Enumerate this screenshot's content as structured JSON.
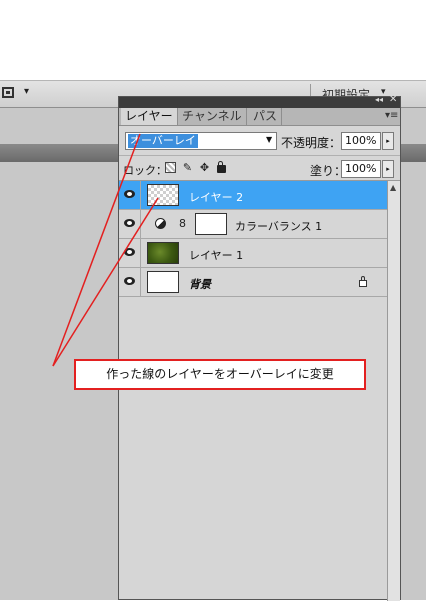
{
  "options_bar": {
    "screen_mode_icon": "screen-mode-icon",
    "screen_mode_arrow": "▾",
    "workspace_label": "初期設定",
    "workspace_arrow": "▾"
  },
  "panel": {
    "collapse_glyph": "◂◂",
    "close_glyph": "✕",
    "tabs": [
      {
        "label": "レイヤー",
        "active": true
      },
      {
        "label": "チャンネル",
        "active": false
      },
      {
        "label": "パス",
        "active": false
      }
    ],
    "menu_glyph": "▾≡",
    "blend_mode": {
      "value": "オーバーレイ",
      "arrow": "▼"
    },
    "opacity": {
      "label": "不透明度：",
      "value": "100%",
      "stepper": "▸"
    },
    "lock": {
      "label": "ロック：",
      "paint_glyph": "✎",
      "move_glyph": "✥"
    },
    "fill": {
      "label": "塗り：",
      "value": "100%",
      "stepper": "▸"
    },
    "layers": [
      {
        "name": "レイヤー 2",
        "selected": true,
        "thumbnail": "transparent"
      },
      {
        "name": "カラーバランス 1",
        "selected": false,
        "thumbnail": "white",
        "adjustment": true,
        "link_glyph": "8"
      },
      {
        "name": "レイヤー 1",
        "selected": false,
        "thumbnail": "green-texture"
      },
      {
        "name": "背景",
        "selected": false,
        "thumbnail": "white",
        "locked": true
      }
    ],
    "scroll_up_glyph": "▲"
  },
  "annotation": {
    "text": "作った線のレイヤーをオーバーレイに変更",
    "color": "#e32020"
  },
  "colors": {
    "selection": "#3ea3f3",
    "panel_bg": "#d6d6d6",
    "workspace_bg": "#c8c8c8"
  }
}
